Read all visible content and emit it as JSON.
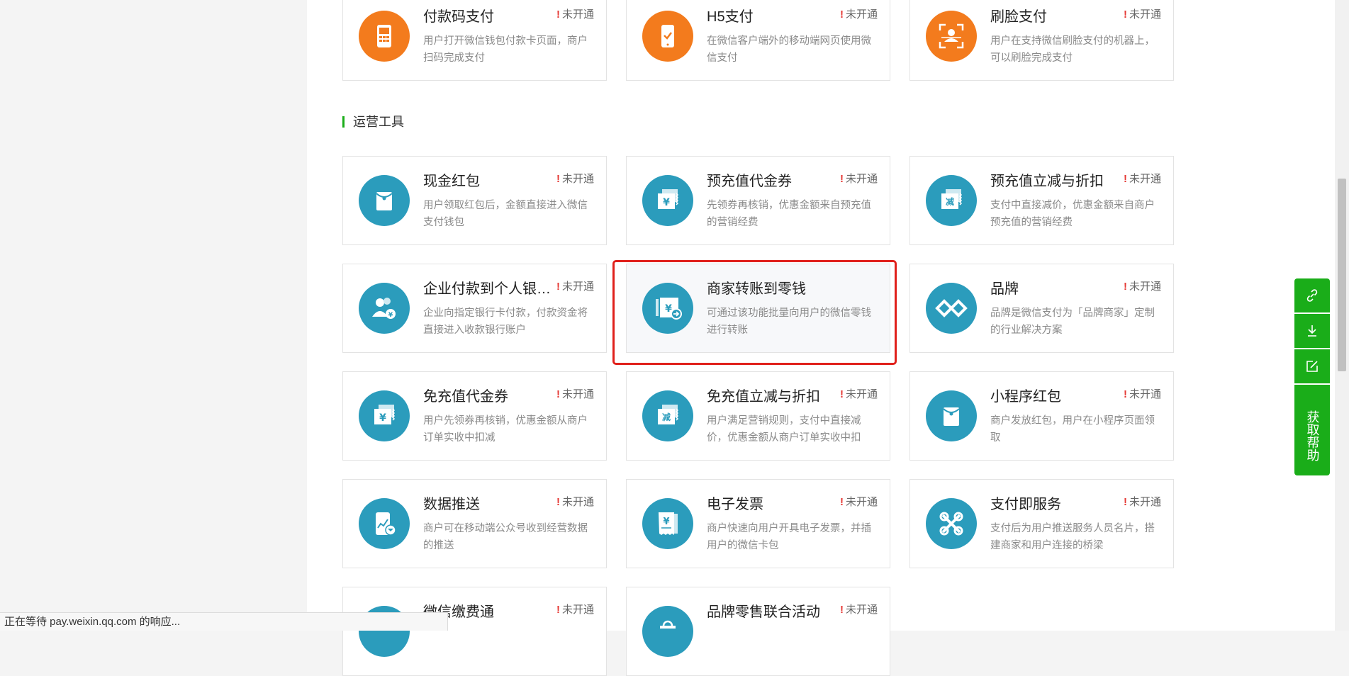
{
  "top_row": [
    {
      "title": "付款码支付",
      "status": "未开通",
      "desc": "用户打开微信钱包付款卡页面，商户扫码完成支付",
      "icon": "payment-code-terminal-icon"
    },
    {
      "title": "H5支付",
      "status": "未开通",
      "desc": "在微信客户端外的移动端网页使用微信支付",
      "icon": "mobile-check-icon"
    },
    {
      "title": "刷脸支付",
      "status": "未开通",
      "desc": "用户在支持微信刷脸支付的机器上，可以刷脸完成支付",
      "icon": "face-scan-icon"
    }
  ],
  "section": {
    "title": "运营工具"
  },
  "tools": [
    {
      "title": "现金红包",
      "status": "未开通",
      "desc": "用户领取红包后，金额直接进入微信支付钱包",
      "icon": "red-envelope-icon"
    },
    {
      "title": "预充值代金券",
      "status": "未开通",
      "desc": "先领券再核销，优惠金额来自预充值的营销经费",
      "icon": "voucher-yen-icon"
    },
    {
      "title": "预充值立减与折扣",
      "status": "未开通",
      "desc": "支付中直接减价，优惠金额来自商户预充值的营销经费",
      "icon": "discount-ticket-icon"
    },
    {
      "title": "企业付款到个人银行卡",
      "status": "未开通",
      "desc": "企业向指定银行卡付款，付款资金将直接进入收款银行账户",
      "icon": "people-payment-icon"
    },
    {
      "title": "商家转账到零钱",
      "status": "",
      "desc": "可通过该功能批量向用户的微信零钱进行转账",
      "icon": "transfer-yen-icon"
    },
    {
      "title": "品牌",
      "status": "未开通",
      "desc": "品牌是微信支付为「品牌商家」定制的行业解决方案",
      "icon": "brand-diamond-icon"
    },
    {
      "title": "免充值代金券",
      "status": "未开通",
      "desc": "用户先领券再核销，优惠金额从商户订单实收中扣减",
      "icon": "voucher-yen-icon"
    },
    {
      "title": "免充值立减与折扣",
      "status": "未开通",
      "desc": "用户满足营销规则，支付中直接减价，优惠金额从商户订单实收中扣",
      "icon": "discount-ticket-icon"
    },
    {
      "title": "小程序红包",
      "status": "未开通",
      "desc": "商户发放红包，用户在小程序页面领取",
      "icon": "red-envelope-icon"
    },
    {
      "title": "数据推送",
      "status": "未开通",
      "desc": "商户可在移动端公众号收到经营数据的推送",
      "icon": "phone-chart-icon"
    },
    {
      "title": "电子发票",
      "status": "未开通",
      "desc": "商户快速向用户开具电子发票，并插用户的微信卡包",
      "icon": "invoice-icon"
    },
    {
      "title": "支付即服务",
      "status": "未开通",
      "desc": "支付后为用户推送服务人员名片，搭建商家和用户连接的桥梁",
      "icon": "service-link-icon"
    },
    {
      "title": "微信缴费通",
      "status": "未开通",
      "desc": "",
      "icon": "fee-payment-icon"
    },
    {
      "title": "品牌零售联合活动",
      "status": "未开通",
      "desc": "",
      "icon": "shopping-bag-icon"
    }
  ],
  "float_help": {
    "label": "获取帮助"
  },
  "browser_status": {
    "text": "正在等待 pay.weixin.qq.com 的响应..."
  },
  "colors": {
    "orange": "#f37b1d",
    "teal": "#2b9cbc",
    "green": "#1aad19",
    "alert": "#e53935",
    "highlight": "#e0201b"
  }
}
